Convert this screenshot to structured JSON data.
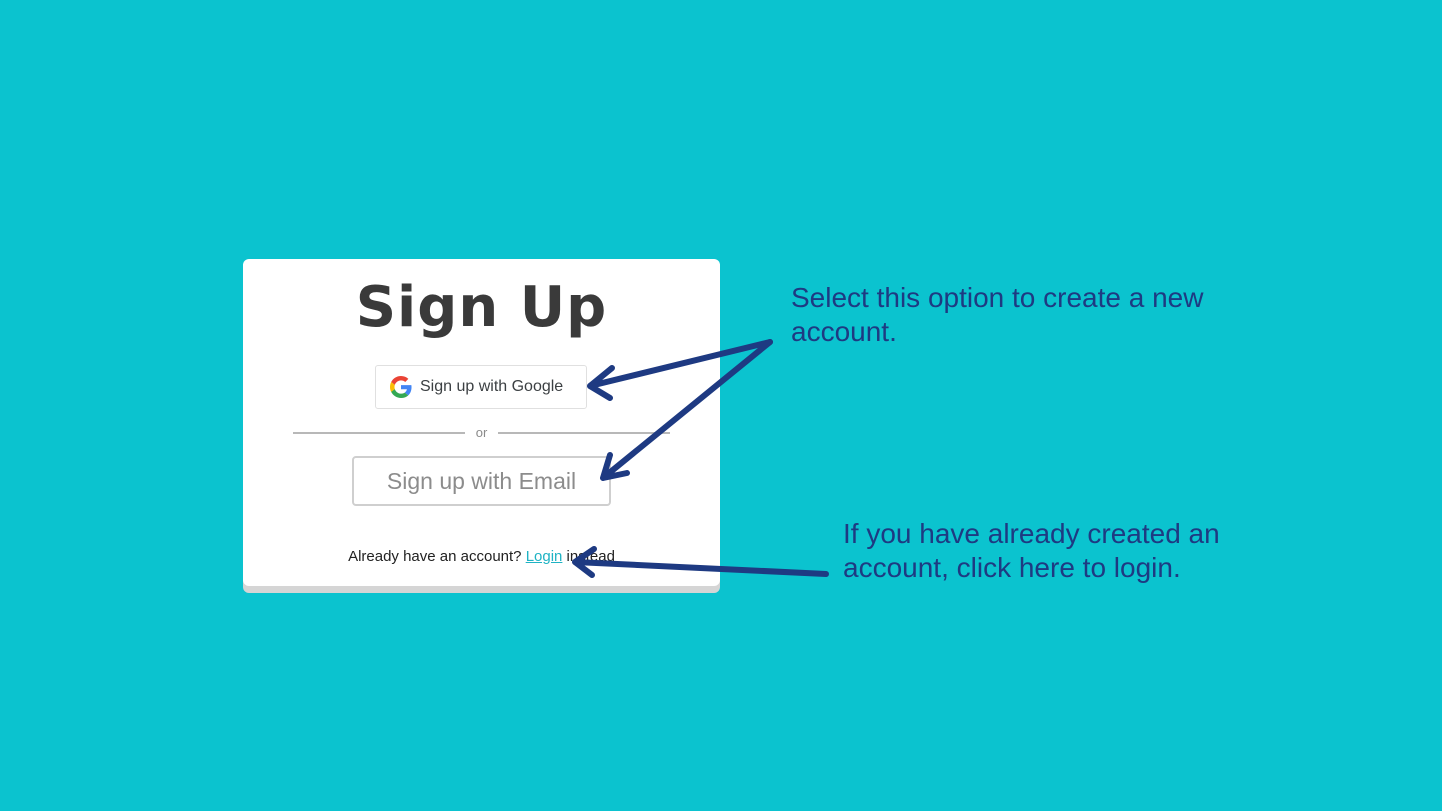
{
  "signup": {
    "title": "Sign Up",
    "google_button_label": "Sign up with Google",
    "divider_label": "or",
    "email_button_label": "Sign up with Email",
    "login_prompt": "Already have an account? ",
    "login_link_label": "Login",
    "login_suffix": " instead"
  },
  "annotations": {
    "signup_options_note": "Select this option to create a new account.",
    "login_note": "If you have already created an account, click here to login."
  },
  "colors": {
    "background": "#0bc3cf",
    "annotation_text": "#1e3a82",
    "arrow": "#1e3a82",
    "link": "#1fb3c4"
  },
  "icons": {
    "google": "google-g-icon"
  }
}
